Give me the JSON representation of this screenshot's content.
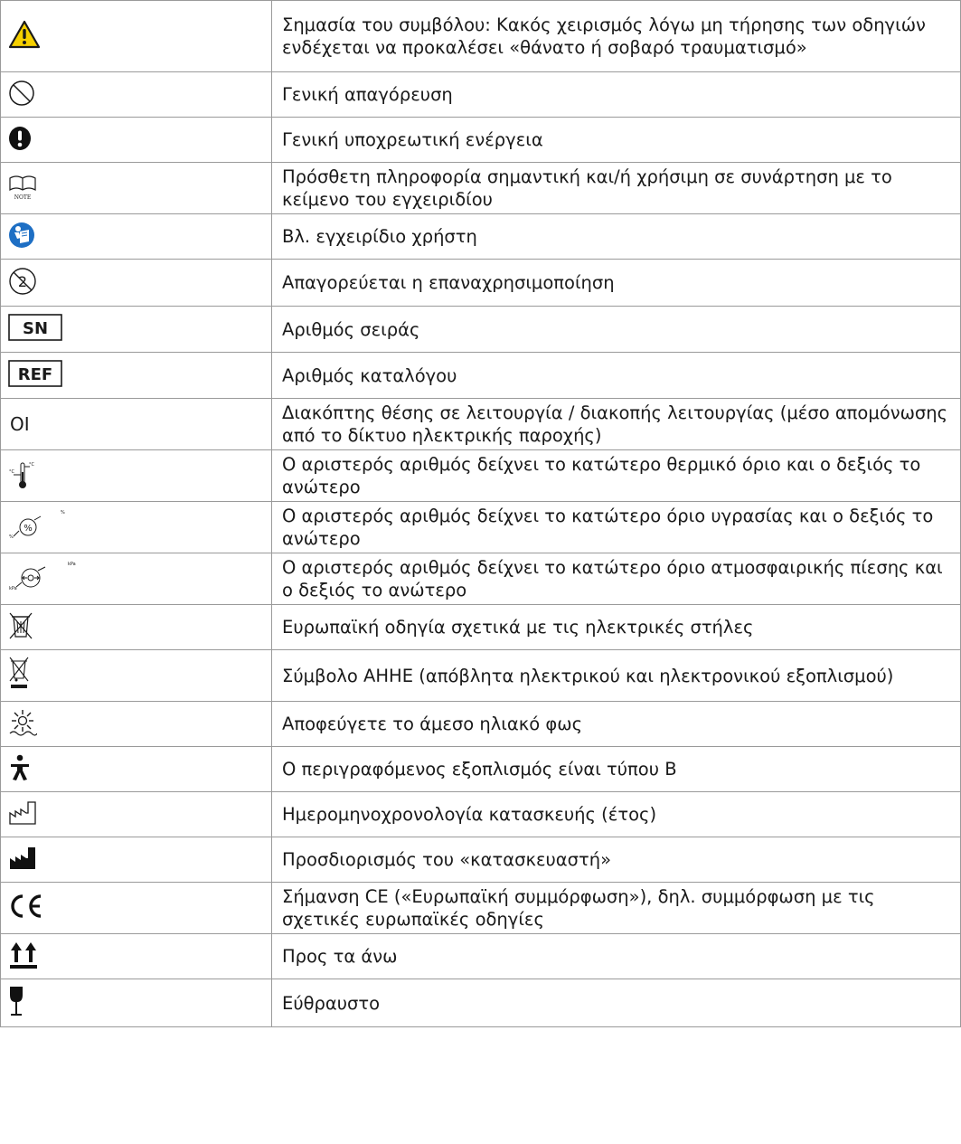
{
  "rows": [
    {
      "icon": "warning-triangle-icon",
      "text": "Σημασία του συμβόλου: Κακός χειρισμός λόγω μη τήρησης των οδηγιών ενδέχεται να προκαλέσει «θάνατο ή σοβαρό τραυματισμό»"
    },
    {
      "icon": "general-prohibition-icon",
      "text": "Γενική απαγόρευση"
    },
    {
      "icon": "mandatory-action-icon",
      "text": "Γενική υποχρεωτική ενέργεια"
    },
    {
      "icon": "note-book-icon",
      "text": "Πρόσθετη πληροφορία σημαντική και/ή χρήσιμη σε συνάρτηση με το κείμενο του εγχειριδίου"
    },
    {
      "icon": "read-manual-icon",
      "text": "Βλ. εγχειρίδιο χρήστη"
    },
    {
      "icon": "do-not-reuse-icon",
      "text": "Απαγορεύεται η επαναχρησιμοποίηση"
    },
    {
      "icon": "serial-number-icon",
      "text": "Αριθμός σειράς"
    },
    {
      "icon": "catalogue-reference-icon",
      "text": "Αριθμός καταλόγου"
    },
    {
      "icon": "on-off-symbol",
      "text": "Διακόπτης θέσης σε λειτουργία / διακοπής λειτουργίας (μέσο απομόνωσης από το δίκτυο ηλεκτρικής παροχής)"
    },
    {
      "icon": "temperature-limit-icon",
      "text": "Ο αριστερός αριθμός δείχνει το κατώτερο θερμικό όριο και ο δεξιός το ανώτερο"
    },
    {
      "icon": "humidity-limit-icon",
      "text": "Ο αριστερός αριθμός δείχνει το κατώτερο όριο υγρασίας και ο δεξιός το ανώτερο"
    },
    {
      "icon": "pressure-limit-icon",
      "text": "Ο αριστερός αριθμός δείχνει το κατώτερο όριο ατμοσφαιρικής πίεσης και ο δεξιός το ανώτερο"
    },
    {
      "icon": "battery-disposal-icon",
      "text": "Ευρωπαϊκή οδηγία σχετικά με τις ηλεκτρικές στήλες"
    },
    {
      "icon": "weee-icon",
      "text": "Σύμβολο ΑΗΗΕ (απόβλητα ηλεκτρικού και ηλεκτρονικού εξοπλισμού)"
    },
    {
      "icon": "keep-away-sunlight-icon",
      "text": "Αποφεύγετε το άμεσο ηλιακό φως"
    },
    {
      "icon": "type-b-applied-part-icon",
      "text": "Ο περιγραφόμενος εξοπλισμός είναι τύπου Β"
    },
    {
      "icon": "date-of-manufacture-icon",
      "text": "Ημερομηνοχρονολογία κατασκευής (έτος)"
    },
    {
      "icon": "manufacturer-icon",
      "text": "Προσδιορισμός του «κατασκευαστή»"
    },
    {
      "icon": "ce-mark-icon",
      "text": "Σήμανση CE («Ευρωπαϊκή συμμόρφωση»), δηλ. συμμόρφωση με τις σχετικές ευρωπαϊκές οδηγίες"
    },
    {
      "icon": "this-way-up-icon",
      "text": "Προς τα άνω"
    },
    {
      "icon": "fragile-icon",
      "text": "Εύθραυστο"
    }
  ],
  "symbol_labels": {
    "serial": "SN",
    "reference": "REF",
    "on_off": "OI",
    "temp_unit": "°C",
    "humidity_unit": "%",
    "pressure_unit": "kPa"
  },
  "colors": {
    "warning_yellow": "#f6d000",
    "manual_blue": "#1e6fc4",
    "border": "#9a9a9a",
    "text": "#1a1a1a"
  }
}
